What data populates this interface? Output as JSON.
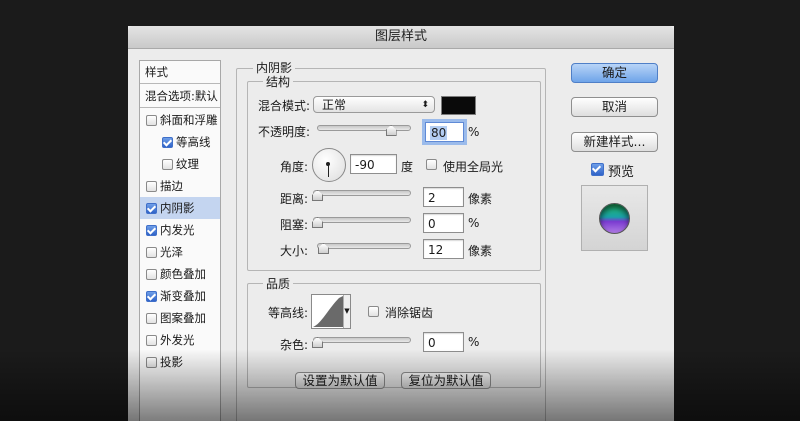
{
  "window": {
    "title": "图层样式"
  },
  "style_list": {
    "header": "样式",
    "blend_options": "混合选项:默认",
    "items": [
      {
        "label": "斜面和浮雕",
        "checked": false,
        "sub": false,
        "selected": false
      },
      {
        "label": "等高线",
        "checked": true,
        "sub": true,
        "selected": false
      },
      {
        "label": "纹理",
        "checked": false,
        "sub": true,
        "selected": false
      },
      {
        "label": "描边",
        "checked": false,
        "sub": false,
        "selected": false
      },
      {
        "label": "内阴影",
        "checked": true,
        "sub": false,
        "selected": true
      },
      {
        "label": "内发光",
        "checked": true,
        "sub": false,
        "selected": false
      },
      {
        "label": "光泽",
        "checked": false,
        "sub": false,
        "selected": false
      },
      {
        "label": "颜色叠加",
        "checked": false,
        "sub": false,
        "selected": false
      },
      {
        "label": "渐变叠加",
        "checked": true,
        "sub": false,
        "selected": false
      },
      {
        "label": "图案叠加",
        "checked": false,
        "sub": false,
        "selected": false
      },
      {
        "label": "外发光",
        "checked": false,
        "sub": false,
        "selected": false
      },
      {
        "label": "投影",
        "checked": false,
        "sub": false,
        "selected": false
      }
    ]
  },
  "inner_shadow": {
    "title": "内阴影",
    "structure": {
      "title": "结构",
      "blend_mode_label": "混合模式:",
      "blend_mode_value": "正常",
      "color": "#0a0a0a",
      "opacity_label": "不透明度:",
      "opacity_value": "80",
      "opacity_fraction": 0.8,
      "opacity_unit": "%",
      "angle_label": "角度:",
      "angle_value": "-90",
      "angle_unit": "度",
      "global_light_label": "使用全局光",
      "global_light_checked": false,
      "distance_label": "距离:",
      "distance_value": "2",
      "distance_unit": "像素",
      "choke_label": "阻塞:",
      "choke_value": "0",
      "choke_unit": "%",
      "size_label": "大小:",
      "size_value": "12",
      "size_unit": "像素"
    },
    "quality": {
      "title": "品质",
      "contour_label": "等高线:",
      "antialias_label": "消除锯齿",
      "antialias_checked": false,
      "noise_label": "杂色:",
      "noise_value": "0",
      "noise_unit": "%"
    },
    "make_default": "设置为默认值",
    "reset_default": "复位为默认值"
  },
  "buttons": {
    "ok": "确定",
    "cancel": "取消",
    "new_style": "新建样式...",
    "preview_label": "预览",
    "preview_checked": true
  },
  "icons": {
    "dropdown": "chevron-updown-icon",
    "angle_dial": "angle-dial-icon",
    "contour": "contour-curve-icon",
    "preview_swatch": "preview-swatch-icon"
  }
}
